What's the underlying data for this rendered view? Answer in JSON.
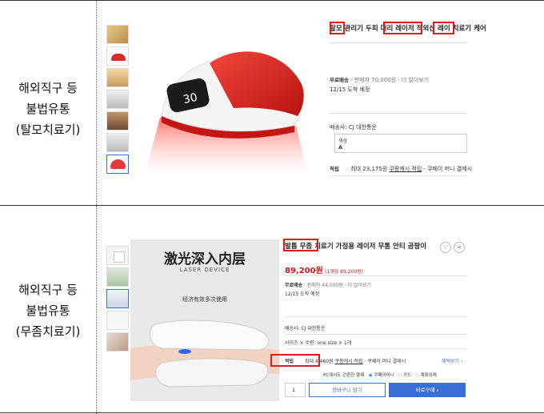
{
  "rows": [
    {
      "label_lines": [
        "해외직구 등",
        "불법유통",
        "(탈모치료기)"
      ],
      "product": {
        "title": "탈모 관리기 두피 머리 레이저 적외선 레이 치료기 케어",
        "highlights": [
          "탈모",
          "레이저 적외선",
          "치료기"
        ],
        "shipping_label": "무료배송",
        "shipping_note": "· 판매자 70,000원 · 더 알아보기",
        "arrival": "12/15 도착 예정",
        "seller_label": "배송사: CJ 대한통운",
        "option_label": "색상",
        "option_value": "A",
        "points_label": "적립",
        "points_text": "최대 23,175원",
        "points_link": "쿠팡캐시 적립",
        "points_tail": "· 쿠페이 머니 결제시",
        "display_reading": "30"
      }
    },
    {
      "label_lines": [
        "해외직구 등",
        "불법유통",
        "(무좀치료기)"
      ],
      "product": {
        "title": "발톱 무좀 치료기 가정용 레이저 무통 안티 곰팡이",
        "highlights": [
          "발톱 무좀 치료기"
        ],
        "price": "89,200원",
        "price_note": "(1개당 89,200원)",
        "shipping_label": "무료배송",
        "shipping_note": "· 판매자 44,000원 · 더 알아보기",
        "arrival": "12/15 도착 예정",
        "seller_label": "배송사: CJ 대한통운",
        "size_line": "사이즈 × 수량: one size × 1개",
        "points_label": "적립",
        "points_text": "최대 4,460원",
        "points_link": "쿠팡캐시 적립",
        "points_tail": "· 쿠페이 머니 결제시",
        "benefit_link": "혜택보기 ›",
        "pay_line": "PC에서도 간편한 결제",
        "pay_opt1": "쿠페이머니",
        "pay_opt2": "카드",
        "pay_opt3": "계좌이체",
        "image_headline": "激光深入内层",
        "image_sub": "LASER DEVICE",
        "image_caption": "经济有效多次使用",
        "qty": "1",
        "cart_btn": "장바구니 담기",
        "buy_btn": "바로구매 ›"
      }
    }
  ],
  "colors": {
    "highlight_box": "#e01b1b",
    "accent_blue": "#3b6fd8",
    "price_red": "#d7141a",
    "device_red": "#d9251f"
  },
  "icons": [
    "heart-icon",
    "share-icon"
  ]
}
